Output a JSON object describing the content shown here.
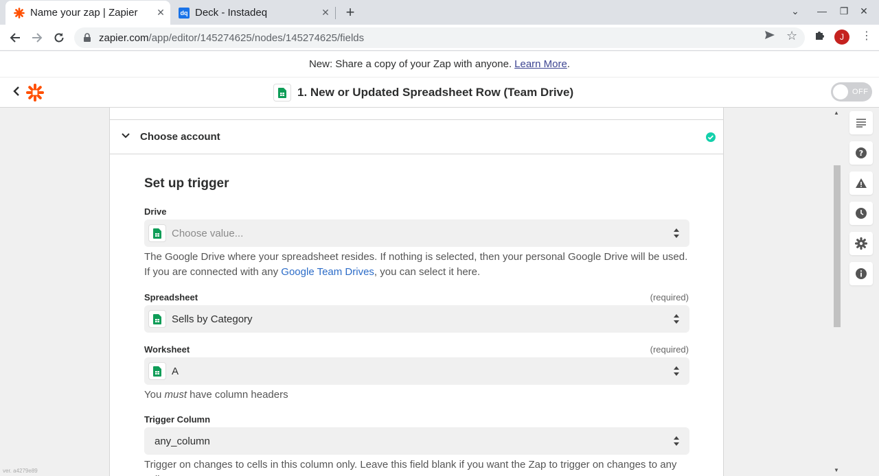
{
  "browser": {
    "tabs": [
      {
        "title": "Name your zap | Zapier",
        "icon": "zapier-asterisk-icon",
        "active": true
      },
      {
        "title": "Deck - Instadeq",
        "icon": "instadeq-dq-icon",
        "favicon_text": "dq",
        "active": false
      }
    ],
    "url_host": "zapier.com",
    "url_path": "/app/editor/145274625/nodes/145274625/fields",
    "profile_initial": "J"
  },
  "banner": {
    "text": "New: Share a copy of your Zap with anyone.",
    "link": "Learn More",
    "suffix": "."
  },
  "header": {
    "step_title": "1. New or Updated Spreadsheet Row (Team Drive)",
    "toggle_label": "OFF"
  },
  "account_section": {
    "label": "Choose account"
  },
  "setup": {
    "title": "Set up trigger",
    "fields": {
      "drive": {
        "label": "Drive",
        "placeholder": "Choose value...",
        "help_before": "The Google Drive where your spreadsheet resides. If nothing is selected, then your personal Google Drive will be used. If you are connected with any ",
        "help_link": "Google Team Drives",
        "help_after": ", you can select it here."
      },
      "spreadsheet": {
        "label": "Spreadsheet",
        "required": "(required)",
        "value": "Sells by Category"
      },
      "worksheet": {
        "label": "Worksheet",
        "required": "(required)",
        "value": "A",
        "help_before": "You ",
        "help_em": "must",
        "help_after": " have column headers"
      },
      "trigger_column": {
        "label": "Trigger Column",
        "value": "any_column",
        "help": "Trigger on changes to cells in this column only. Leave this field blank if you want the Zap to trigger on changes to any cell"
      }
    }
  },
  "sidebar_icons": [
    "details-icon",
    "help-icon",
    "alert-icon",
    "history-icon",
    "settings-icon",
    "info-icon"
  ],
  "version": "ver. a4279e89",
  "colors": {
    "zapier_orange": "#ff4f00",
    "sheets_green": "#0f9d58",
    "success_green": "#13d0ab",
    "link_blue": "#2c6cc8"
  }
}
